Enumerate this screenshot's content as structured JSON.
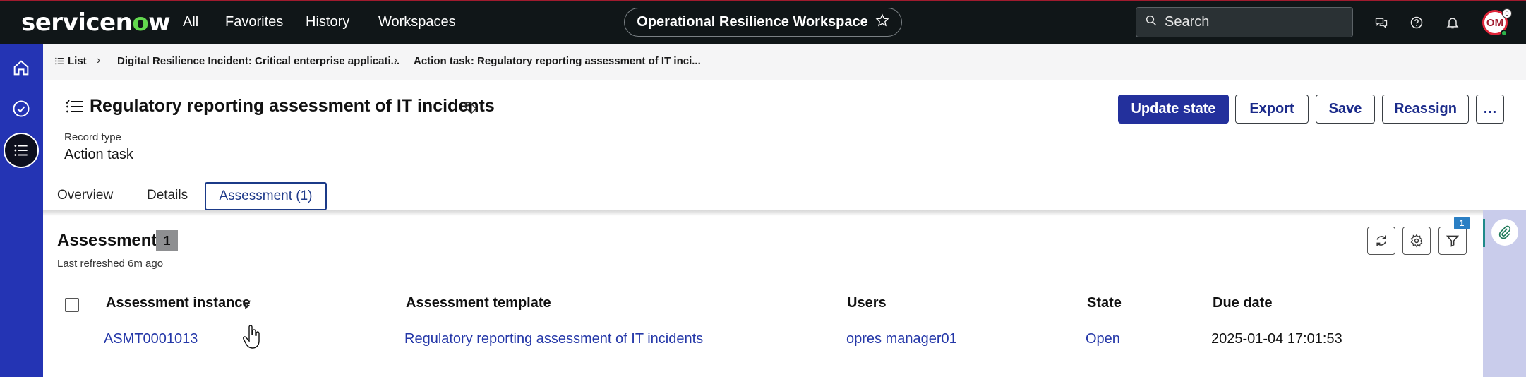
{
  "topbar": {
    "logo_prefix": "servicen",
    "logo_o": "o",
    "logo_suffix": "w",
    "nav": [
      "All",
      "Favorites",
      "History",
      "Workspaces"
    ],
    "workspace_title": "Operational Resilience Workspace",
    "search_placeholder": "Search",
    "avatar_initials": "OM",
    "avatar_badge": "0",
    "icons": [
      "chat-icon",
      "help-icon",
      "bell-icon"
    ]
  },
  "rail": {
    "items": [
      "home-icon",
      "check-circle-icon",
      "list-icon"
    ]
  },
  "breadcrumb": {
    "list_label": "List",
    "item1": "Digital Resilience Incident: Critical enterprise applicati...",
    "item2": "Action task: Regulatory reporting assessment of IT inci..."
  },
  "record": {
    "title": "Regulatory reporting assessment of IT incidents",
    "type_label": "Record type",
    "type_value": "Action task"
  },
  "actions": {
    "update_state": "Update state",
    "export": "Export",
    "save": "Save",
    "reassign": "Reassign",
    "more": "…"
  },
  "tabs": [
    {
      "label": "Overview"
    },
    {
      "label": "Details"
    },
    {
      "label": "Assessment (1)"
    }
  ],
  "assessment": {
    "title": "Assessment",
    "count": "1",
    "refreshed": "Last refreshed 6m ago",
    "filter_badge": "1",
    "columns": [
      "Assessment instance",
      "Assessment template",
      "Users",
      "State",
      "Due date"
    ],
    "rows": [
      {
        "instance": "ASMT0001013",
        "template": "Regulatory reporting assessment of IT incidents",
        "users": "opres manager01",
        "state": "Open",
        "due": "2025-01-04 17:01:53"
      }
    ]
  },
  "colors": {
    "topbar_bg": "#101618",
    "rail_bg": "#2434b4",
    "primary_button": "#23309c",
    "link": "#2437a8"
  }
}
